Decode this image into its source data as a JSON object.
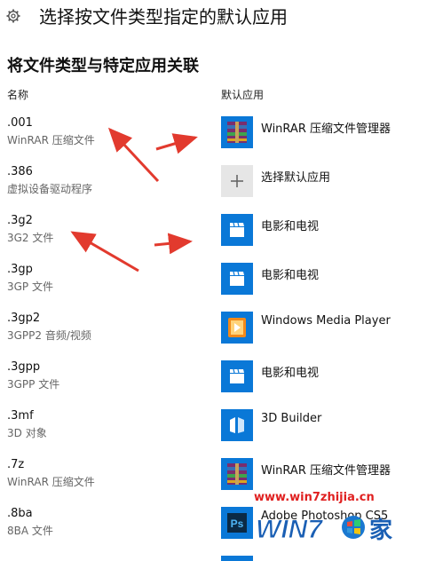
{
  "header": {
    "title": "选择按文件类型指定的默认应用",
    "icon": "gear-icon"
  },
  "section": {
    "title": "将文件类型与特定应用关联"
  },
  "columns": {
    "name": "名称",
    "default_app": "默认应用"
  },
  "rows": [
    {
      "ext": ".001",
      "desc": "WinRAR 压缩文件",
      "app": "WinRAR 压缩文件管理器",
      "icon": "winrar-icon"
    },
    {
      "ext": ".386",
      "desc": "虚拟设备驱动程序",
      "app": "选择默认应用",
      "icon": "plus-icon"
    },
    {
      "ext": ".3g2",
      "desc": "3G2 文件",
      "app": "电影和电视",
      "icon": "movies-tv-icon"
    },
    {
      "ext": ".3gp",
      "desc": "3GP 文件",
      "app": "电影和电视",
      "icon": "movies-tv-icon"
    },
    {
      "ext": ".3gp2",
      "desc": "3GPP2 音频/视频",
      "app": "Windows Media Player",
      "icon": "windows-media-player-icon"
    },
    {
      "ext": ".3gpp",
      "desc": "3GPP 文件",
      "app": "电影和电视",
      "icon": "movies-tv-icon"
    },
    {
      "ext": ".3mf",
      "desc": "3D 对象",
      "app": "3D Builder",
      "icon": "3d-builder-icon"
    },
    {
      "ext": ".7z",
      "desc": "WinRAR 压缩文件",
      "app": "WinRAR 压缩文件管理器",
      "icon": "winrar-icon"
    },
    {
      "ext": ".8ba",
      "desc": "8BA 文件",
      "app": "Adobe Photoshop CS5",
      "icon": "photoshop-icon"
    }
  ],
  "watermark": {
    "url": "www.win7zhijia.cn",
    "logo_text": "WIN7之家"
  },
  "colors": {
    "app_blue": "#0a78d7",
    "annotation_red": "#e23a2e",
    "gray_tile": "#e6e6e6"
  }
}
